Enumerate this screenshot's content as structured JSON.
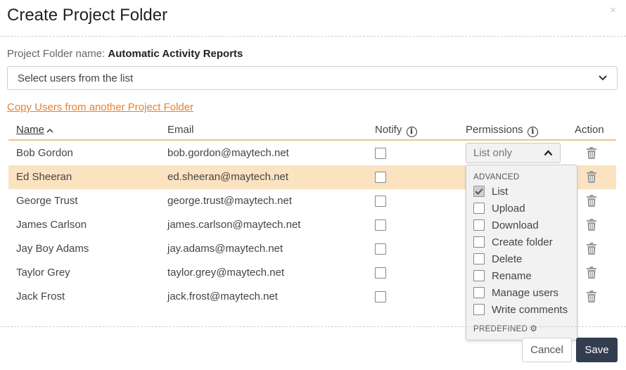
{
  "modal": {
    "title": "Create Project Folder",
    "close": "×"
  },
  "folder": {
    "label": "Project Folder name:",
    "name": "Automatic Activity Reports"
  },
  "select_users": {
    "placeholder": "Select users from the list"
  },
  "copy_link": "Copy Users from another Project Folder",
  "table": {
    "headers": {
      "name": "Name",
      "email": "Email",
      "notify": "Notify",
      "permissions": "Permissions",
      "action": "Action"
    },
    "rows": [
      {
        "name": "Bob Gordon",
        "email": "bob.gordon@maytech.net"
      },
      {
        "name": "Ed Sheeran",
        "email": "ed.sheeran@maytech.net"
      },
      {
        "name": "George Trust",
        "email": "george.trust@maytech.net"
      },
      {
        "name": "James Carlson",
        "email": "james.carlson@maytech.net"
      },
      {
        "name": "Jay Boy Adams",
        "email": "jay.adams@maytech.net"
      },
      {
        "name": "Taylor Grey",
        "email": "taylor.grey@maytech.net"
      },
      {
        "name": "Jack Frost",
        "email": "jack.frost@maytech.net"
      }
    ]
  },
  "permissions": {
    "selected": "List only",
    "advanced_heading": "ADVANCED",
    "options": [
      {
        "label": "List",
        "checked": true
      },
      {
        "label": "Upload",
        "checked": false
      },
      {
        "label": "Download",
        "checked": false
      },
      {
        "label": "Create folder",
        "checked": false
      },
      {
        "label": "Delete",
        "checked": false
      },
      {
        "label": "Rename",
        "checked": false
      },
      {
        "label": "Manage users",
        "checked": false
      },
      {
        "label": "Write comments",
        "checked": false
      }
    ],
    "predefined_heading": "PREDEFINED"
  },
  "footer": {
    "cancel": "Cancel",
    "save": "Save"
  },
  "colors": {
    "accent": "#e8812e",
    "highlight_row": "#fbe3c1",
    "save_button": "#323e4f",
    "header_underline": "#ecc48f"
  },
  "icons": {
    "close": "close-icon",
    "sort": "sort-up-icon",
    "info": "info-icon",
    "trash": "trash-icon",
    "chevron": "chevron-down-icon",
    "gear": "gear-icon"
  }
}
